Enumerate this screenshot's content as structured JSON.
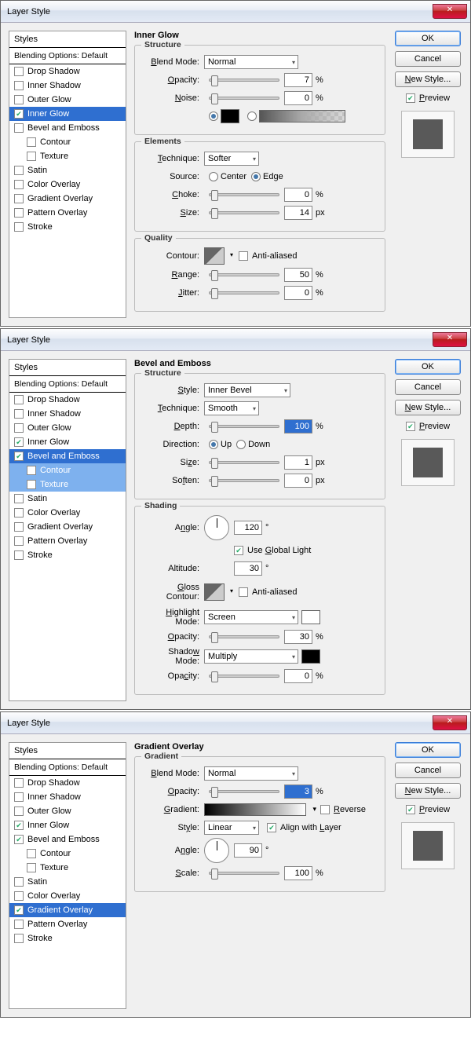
{
  "common": {
    "title": "Layer Style",
    "styles_header": "Styles",
    "blending_default": "Blending Options: Default",
    "ok": "OK",
    "cancel": "Cancel",
    "new_style": "New Style...",
    "preview": "Preview",
    "items": {
      "drop_shadow": "Drop Shadow",
      "inner_shadow": "Inner Shadow",
      "outer_glow": "Outer Glow",
      "inner_glow": "Inner Glow",
      "bevel_emboss": "Bevel and Emboss",
      "contour": "Contour",
      "texture": "Texture",
      "satin": "Satin",
      "color_overlay": "Color Overlay",
      "gradient_overlay": "Gradient Overlay",
      "pattern_overlay": "Pattern Overlay",
      "stroke": "Stroke"
    }
  },
  "dlg1": {
    "section": "Inner Glow",
    "structure": {
      "title": "Structure",
      "blend_mode": "Normal",
      "opacity": "7",
      "noise": "0",
      "lbl_bm": "Blend Mode:",
      "lbl_op": "Opacity:",
      "lbl_noise": "Noise:",
      "pct": "%"
    },
    "elements": {
      "title": "Elements",
      "technique": "Softer",
      "lbl_tech": "Technique:",
      "lbl_src": "Source:",
      "center": "Center",
      "edge": "Edge",
      "lbl_choke": "Choke:",
      "choke": "0",
      "lbl_size": "Size:",
      "size": "14",
      "px": "px",
      "pct": "%"
    },
    "quality": {
      "title": "Quality",
      "lbl_contour": "Contour:",
      "anti": "Anti-aliased",
      "lbl_range": "Range:",
      "range": "50",
      "lbl_jitter": "Jitter:",
      "jitter": "0",
      "pct": "%"
    }
  },
  "dlg2": {
    "section": "Bevel and Emboss",
    "structure": {
      "title": "Structure",
      "lbl_style": "Style:",
      "style": "Inner Bevel",
      "lbl_tech": "Technique:",
      "tech": "Smooth",
      "lbl_depth": "Depth:",
      "depth": "100",
      "lbl_dir": "Direction:",
      "up": "Up",
      "down": "Down",
      "lbl_size": "Size:",
      "size": "1",
      "lbl_soften": "Soften:",
      "soften": "0",
      "px": "px",
      "pct": "%"
    },
    "shading": {
      "title": "Shading",
      "lbl_angle": "Angle:",
      "angle": "120",
      "deg": "°",
      "use_global": "Use Global Light",
      "lbl_alt": "Altitude:",
      "alt": "30",
      "lbl_gloss": "Gloss Contour:",
      "anti": "Anti-aliased",
      "lbl_hl": "Highlight Mode:",
      "hl": "Screen",
      "lbl_op": "Opacity:",
      "hl_op": "30",
      "lbl_sh": "Shadow Mode:",
      "sh": "Multiply",
      "sh_op": "0",
      "pct": "%"
    }
  },
  "dlg3": {
    "section": "Gradient Overlay",
    "gradient": {
      "title": "Gradient",
      "lbl_bm": "Blend Mode:",
      "bm": "Normal",
      "lbl_op": "Opacity:",
      "op": "3",
      "lbl_grad": "Gradient:",
      "reverse": "Reverse",
      "lbl_style": "Style:",
      "style": "Linear",
      "align": "Align with Layer",
      "lbl_angle": "Angle:",
      "angle": "90",
      "deg": "°",
      "lbl_scale": "Scale:",
      "scale": "100",
      "pct": "%"
    }
  }
}
